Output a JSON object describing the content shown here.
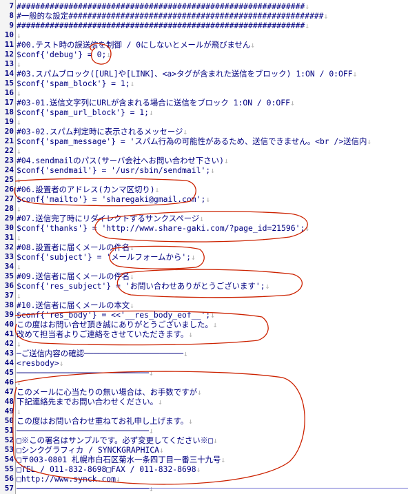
{
  "editor": {
    "lines": [
      {
        "n": "7",
        "t": "#############################################################"
      },
      {
        "n": "8",
        "t": "#一般的な設定######################################################"
      },
      {
        "n": "9",
        "t": "#############################################################"
      },
      {
        "n": "10",
        "t": ""
      },
      {
        "n": "11",
        "t": "#00.テスト時の誤送信を制御 / 0にしないとメールが飛びません"
      },
      {
        "n": "12",
        "t": "$conf{'debug'} = 0;"
      },
      {
        "n": "13",
        "t": ""
      },
      {
        "n": "14",
        "t": "#03.スパムブロック([URL]や[LINK]、<a>タグが含まれた送信をブロック) 1:ON / 0:OFF"
      },
      {
        "n": "15",
        "t": "$conf{'spam_block'} = 1;"
      },
      {
        "n": "16",
        "t": ""
      },
      {
        "n": "17",
        "t": "#03-01.送信文字列にURLが含まれる場合に送信をブロック 1:ON / 0:OFF"
      },
      {
        "n": "18",
        "t": "$conf{'spam_url_block'} = 1;"
      },
      {
        "n": "19",
        "t": ""
      },
      {
        "n": "20",
        "t": "#03-02.スパム判定時に表示されるメッセージ"
      },
      {
        "n": "21",
        "t": "$conf{'spam_message'} = 'スパム行為の可能性があるため、送信できません。<br />送信内"
      },
      {
        "n": "22",
        "t": ""
      },
      {
        "n": "23",
        "t": "#04.sendmailのパス(サーバ会社へお問い合わせ下さい)"
      },
      {
        "n": "24",
        "t": "$conf{'sendmail'} = '/usr/sbin/sendmail';"
      },
      {
        "n": "25",
        "t": ""
      },
      {
        "n": "26",
        "t": "#06.設置者のアドレス(カンマ区切り)"
      },
      {
        "n": "27",
        "t": "$conf{'mailto'} = 'sharegaki@gmail.com';"
      },
      {
        "n": "28",
        "t": ""
      },
      {
        "n": "29",
        "t": "#07.送信完了時にリダイレクトするサンクスページ"
      },
      {
        "n": "30",
        "t": "$conf{'thanks'} = 'http://www.share-gaki.com/?page_id=21596';"
      },
      {
        "n": "31",
        "t": ""
      },
      {
        "n": "32",
        "t": "#08.設置者に届くメールの件名"
      },
      {
        "n": "33",
        "t": "$conf{'subject'} = 'メールフォームから';"
      },
      {
        "n": "34",
        "t": ""
      },
      {
        "n": "35",
        "t": "#09.送信者に届くメールの件名"
      },
      {
        "n": "36",
        "t": "$conf{'res_subject'} = 'お問い合わせありがとうございます';"
      },
      {
        "n": "37",
        "t": ""
      },
      {
        "n": "38",
        "t": "#10.送信者に届くメールの本文"
      },
      {
        "n": "39",
        "t": "$conf{'res_body'} = <<'__res_body_eof__';"
      },
      {
        "n": "40",
        "t": "この度はお問い合せ頂き誠にありがとうございました。"
      },
      {
        "n": "41",
        "t": "改めて担当者よりご連絡をさせていただきます。"
      },
      {
        "n": "42",
        "t": ""
      },
      {
        "n": "43",
        "t": "─ご送信内容の確認─────────────────────"
      },
      {
        "n": "44",
        "t": "<resbody>"
      },
      {
        "n": "45",
        "t": "────────────────────────────"
      },
      {
        "n": "46",
        "t": ""
      },
      {
        "n": "47",
        "t": "このメールに心当たりの無い場合は、お手数ですが"
      },
      {
        "n": "48",
        "t": "下記連絡先までお問い合わせください。"
      },
      {
        "n": "49",
        "t": ""
      },
      {
        "n": "50",
        "t": "この度はお問い合わせ重ねてお礼申し上げます。"
      },
      {
        "n": "51",
        "t": "────────────────────────────"
      },
      {
        "n": "52",
        "t": "□※この署名はサンプルです。必ず変更してください※□"
      },
      {
        "n": "53",
        "t": "□シンクグラフィカ / SYNCKGRAPHICA"
      },
      {
        "n": "54",
        "t": "□〒003-0801 札幌市白石区菊水一条四丁目一番三十九号"
      },
      {
        "n": "55",
        "t": "□TEL / 011-832-8698□FAX / 011-832-8698"
      },
      {
        "n": "56",
        "t": "□http://www.synck.com"
      },
      {
        "n": "57",
        "t": "────────────────────────────"
      }
    ],
    "eol": "↓",
    "colors": {
      "text": "#000080",
      "line_number": "#000080",
      "annotation": "#cc2200",
      "gutter": "#f4f4f4"
    }
  }
}
